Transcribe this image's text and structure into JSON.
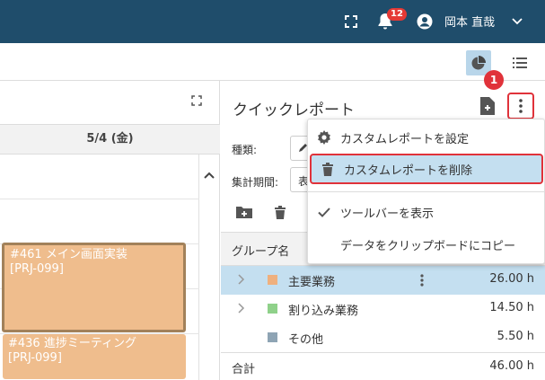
{
  "topbar": {
    "notification_count": "12",
    "user_name": "岡本 直哉",
    "icons": [
      "fullscreen-icon",
      "bell-icon",
      "user-icon",
      "chevron-down-icon"
    ]
  },
  "toolbar": {
    "views": [
      "pie-chart-icon",
      "list-icon"
    ],
    "active_view": "pie-chart-icon"
  },
  "calendar": {
    "day_label": "5/4 (金)",
    "tasks": [
      {
        "title": "#461 メイン画面実装",
        "project": "[PRJ-099]"
      },
      {
        "title": "#436 進捗ミーティング",
        "project": "[PRJ-099]"
      }
    ]
  },
  "quick_report": {
    "title": "クイックレポート",
    "type_label": "種類:",
    "period_label": "集計期間:",
    "period_value": "表",
    "group_header": "グループ名",
    "rows": [
      {
        "name": "主要業務",
        "value": "26.00 h",
        "color": "#efb07e"
      },
      {
        "name": "割り込み業務",
        "value": "14.50 h",
        "color": "#8fd18a"
      },
      {
        "name": "その他",
        "value": "5.50 h",
        "color": "#8ea4b4"
      }
    ],
    "total_label": "合計",
    "total_value": "46.00 h"
  },
  "menu": {
    "items": [
      {
        "label": "カスタムレポートを設定",
        "icon": "gear-icon"
      },
      {
        "label": "カスタムレポートを削除",
        "icon": "trash-icon"
      },
      {
        "label": "ツールバーを表示",
        "icon": "check-icon"
      },
      {
        "label": "データをクリップボードにコピー",
        "icon": ""
      }
    ]
  },
  "annotation": {
    "step": "1"
  },
  "colors": {
    "header": "#1f4d6b",
    "accent": "#e0323a",
    "highlight": "#c4dff0"
  }
}
